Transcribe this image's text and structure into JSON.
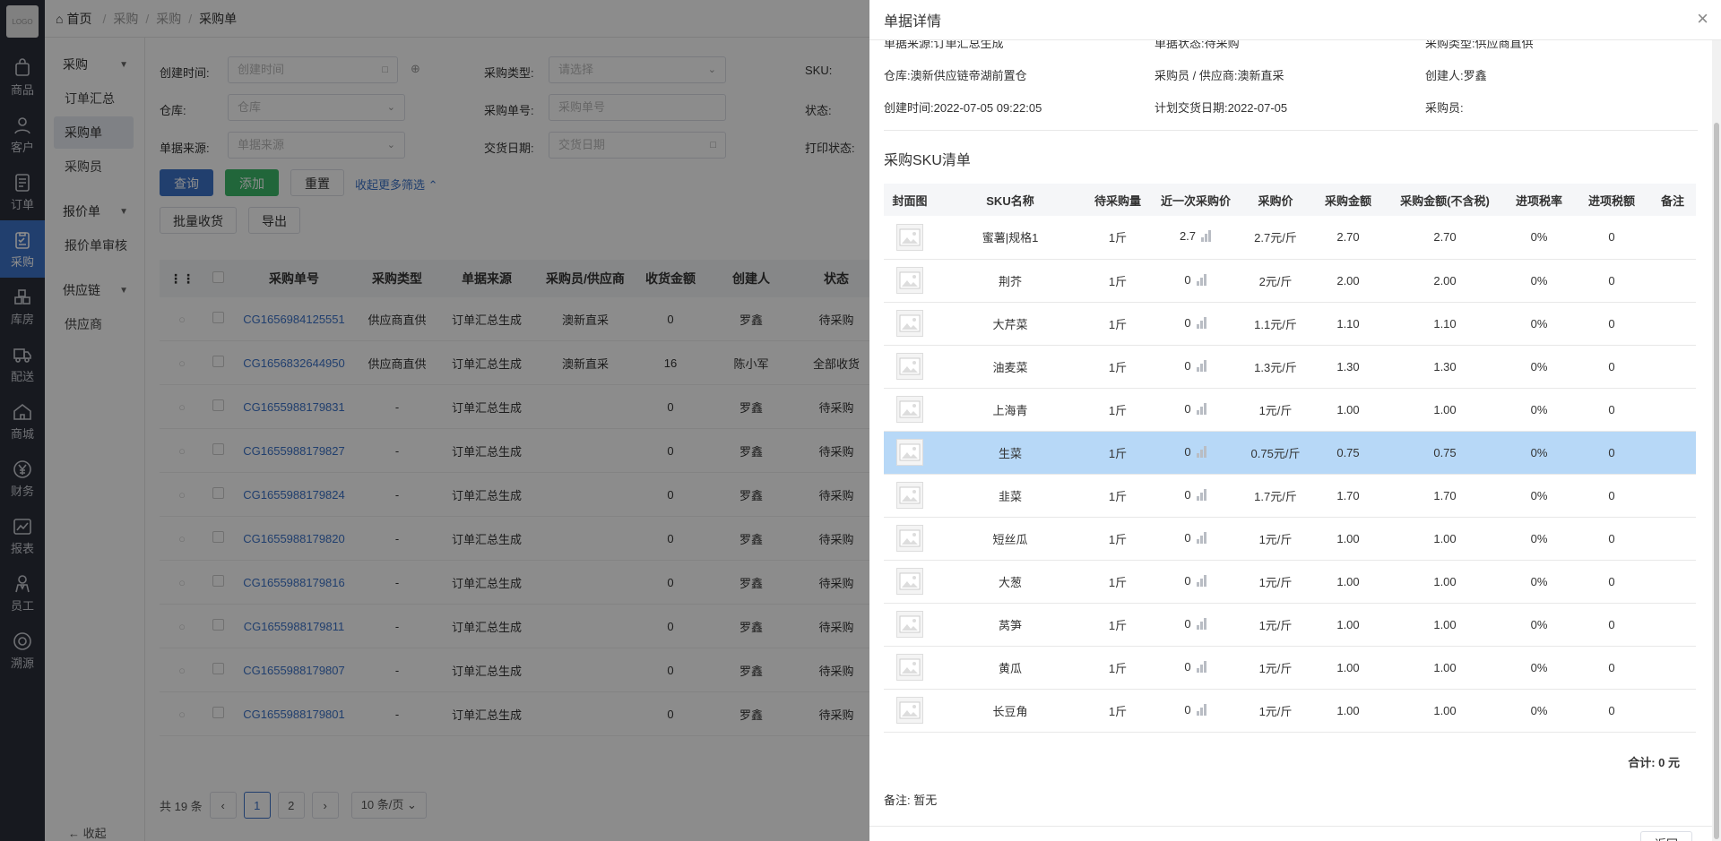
{
  "rail": {
    "logo": "LOGO",
    "items": [
      {
        "label": "商品",
        "icon": "bag-icon"
      },
      {
        "label": "客户",
        "icon": "user-icon"
      },
      {
        "label": "订单",
        "icon": "document-icon"
      },
      {
        "label": "采购",
        "icon": "clipboard-icon",
        "active": true
      },
      {
        "label": "库房",
        "icon": "boxes-icon"
      },
      {
        "label": "配送",
        "icon": "truck-icon"
      },
      {
        "label": "商城",
        "icon": "house-icon"
      },
      {
        "label": "财务",
        "icon": "yen-icon"
      },
      {
        "label": "报表",
        "icon": "chart-icon"
      },
      {
        "label": "员工",
        "icon": "person-icon"
      },
      {
        "label": "溯源",
        "icon": "target-icon"
      }
    ]
  },
  "submenu": {
    "group1": "采购",
    "items1": [
      "订单汇总",
      "采购单",
      "采购员"
    ],
    "group2": "报价单",
    "items2": [
      "报价单审核"
    ],
    "group3": "供应链",
    "items3": [
      "供应商"
    ],
    "collapse": "收起"
  },
  "breadcrumb": {
    "home": "首页",
    "l1": "采购",
    "l2": "采购",
    "current": "采购单"
  },
  "filters": {
    "created_label": "创建时间:",
    "created_ph": "创建时间",
    "type_label": "采购类型:",
    "type_ph": "请选择",
    "sku_label": "SKU:",
    "warehouse_label": "仓库:",
    "warehouse_ph": "仓库",
    "order_no_label": "采购单号:",
    "order_no_ph": "采购单号",
    "status_label": "状态:",
    "source_label": "单据来源:",
    "source_ph": "单据来源",
    "delivery_label": "交货日期:",
    "delivery_ph": "交货日期",
    "print_label": "打印状态:",
    "query": "查询",
    "add": "添加",
    "reset": "重置",
    "more": "收起更多筛选",
    "batch_receive": "批量收货",
    "export": "导出"
  },
  "list": {
    "headers": [
      "采购单号",
      "采购类型",
      "单据来源",
      "采购员/供应商",
      "收货金额",
      "创建人",
      "状态"
    ],
    "rows": [
      {
        "no": "CG1656984125551",
        "type": "供应商直供",
        "source": "订单汇总生成",
        "buyer": "澳新直采",
        "amount": "0",
        "creator": "罗鑫",
        "status": "待采购"
      },
      {
        "no": "CG1656832644950",
        "type": "供应商直供",
        "source": "订单汇总生成",
        "buyer": "澳新直采",
        "amount": "16",
        "creator": "陈小军",
        "status": "全部收货"
      },
      {
        "no": "CG1655988179831",
        "type": "-",
        "source": "订单汇总生成",
        "buyer": "",
        "amount": "0",
        "creator": "罗鑫",
        "status": "待采购"
      },
      {
        "no": "CG1655988179827",
        "type": "-",
        "source": "订单汇总生成",
        "buyer": "",
        "amount": "0",
        "creator": "罗鑫",
        "status": "待采购"
      },
      {
        "no": "CG1655988179824",
        "type": "-",
        "source": "订单汇总生成",
        "buyer": "",
        "amount": "0",
        "creator": "罗鑫",
        "status": "待采购"
      },
      {
        "no": "CG1655988179820",
        "type": "-",
        "source": "订单汇总生成",
        "buyer": "",
        "amount": "0",
        "creator": "罗鑫",
        "status": "待采购"
      },
      {
        "no": "CG1655988179816",
        "type": "-",
        "source": "订单汇总生成",
        "buyer": "",
        "amount": "0",
        "creator": "罗鑫",
        "status": "待采购"
      },
      {
        "no": "CG1655988179811",
        "type": "-",
        "source": "订单汇总生成",
        "buyer": "",
        "amount": "0",
        "creator": "罗鑫",
        "status": "待采购"
      },
      {
        "no": "CG1655988179807",
        "type": "-",
        "source": "订单汇总生成",
        "buyer": "",
        "amount": "0",
        "creator": "罗鑫",
        "status": "待采购"
      },
      {
        "no": "CG1655988179801",
        "type": "-",
        "source": "订单汇总生成",
        "buyer": "",
        "amount": "0",
        "creator": "罗鑫",
        "status": "待采购"
      }
    ]
  },
  "pager": {
    "total": "共 19 条",
    "pages": [
      "1",
      "2"
    ],
    "current": "1",
    "size": "10 条/页"
  },
  "drawer": {
    "title": "单据详情",
    "info": {
      "source": "单据来源:订单汇总生成",
      "state": "单据状态:待采购",
      "ptype": "采购类型:供应商直供",
      "warehouse": "仓库:澳新供应链帝湖前置仓",
      "buyer": "采购员 / 供应商:澳新直采",
      "creator": "创建人:罗鑫",
      "created": "创建时间:2022-07-05 09:22:05",
      "plan_date": "计划交货日期:2022-07-05",
      "purchaser": "采购员:"
    },
    "section": "采购SKU清单",
    "headers": [
      "封面图",
      "SKU名称",
      "待采购量",
      "近一次采购价",
      "采购价",
      "采购金额",
      "采购金额(不含税)",
      "进项税率",
      "进项税额",
      "备注"
    ],
    "rows": [
      {
        "name": "蜜薯|规格1",
        "qty": "1斤",
        "last": "2.7",
        "price": "2.7元/斤",
        "amt": "2.70",
        "amt_nt": "2.70",
        "rate": "0%",
        "tax": "0",
        "note": ""
      },
      {
        "name": "荆芥",
        "qty": "1斤",
        "last": "0",
        "price": "2元/斤",
        "amt": "2.00",
        "amt_nt": "2.00",
        "rate": "0%",
        "tax": "0",
        "note": ""
      },
      {
        "name": "大芹菜",
        "qty": "1斤",
        "last": "0",
        "price": "1.1元/斤",
        "amt": "1.10",
        "amt_nt": "1.10",
        "rate": "0%",
        "tax": "0",
        "note": ""
      },
      {
        "name": "油麦菜",
        "qty": "1斤",
        "last": "0",
        "price": "1.3元/斤",
        "amt": "1.30",
        "amt_nt": "1.30",
        "rate": "0%",
        "tax": "0",
        "note": ""
      },
      {
        "name": "上海青",
        "qty": "1斤",
        "last": "0",
        "price": "1元/斤",
        "amt": "1.00",
        "amt_nt": "1.00",
        "rate": "0%",
        "tax": "0",
        "note": ""
      },
      {
        "name": "生菜",
        "qty": "1斤",
        "last": "0",
        "price": "0.75元/斤",
        "amt": "0.75",
        "amt_nt": "0.75",
        "rate": "0%",
        "tax": "0",
        "note": "",
        "selected": true
      },
      {
        "name": "韭菜",
        "qty": "1斤",
        "last": "0",
        "price": "1.7元/斤",
        "amt": "1.70",
        "amt_nt": "1.70",
        "rate": "0%",
        "tax": "0",
        "note": ""
      },
      {
        "name": "短丝瓜",
        "qty": "1斤",
        "last": "0",
        "price": "1元/斤",
        "amt": "1.00",
        "amt_nt": "1.00",
        "rate": "0%",
        "tax": "0",
        "note": ""
      },
      {
        "name": "大葱",
        "qty": "1斤",
        "last": "0",
        "price": "1元/斤",
        "amt": "1.00",
        "amt_nt": "1.00",
        "rate": "0%",
        "tax": "0",
        "note": ""
      },
      {
        "name": "莴笋",
        "qty": "1斤",
        "last": "0",
        "price": "1元/斤",
        "amt": "1.00",
        "amt_nt": "1.00",
        "rate": "0%",
        "tax": "0",
        "note": ""
      },
      {
        "name": "黄瓜",
        "qty": "1斤",
        "last": "0",
        "price": "1元/斤",
        "amt": "1.00",
        "amt_nt": "1.00",
        "rate": "0%",
        "tax": "0",
        "note": ""
      },
      {
        "name": "长豆角",
        "qty": "1斤",
        "last": "0",
        "price": "1元/斤",
        "amt": "1.00",
        "amt_nt": "1.00",
        "rate": "0%",
        "tax": "0",
        "note": ""
      }
    ],
    "total": "合计: 0 元",
    "remark": "备注: 暂无",
    "back": "返回"
  },
  "colors": {
    "primary": "#3c73c8",
    "success": "#3dbb6b",
    "selected_row": "#b7d8f7",
    "rail": "#2b2f3a"
  }
}
